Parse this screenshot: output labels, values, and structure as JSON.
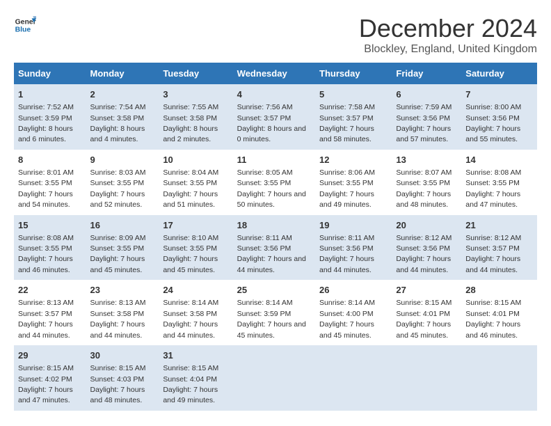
{
  "header": {
    "logo_line1": "General",
    "logo_line2": "Blue",
    "title": "December 2024",
    "subtitle": "Blockley, England, United Kingdom"
  },
  "weekdays": [
    "Sunday",
    "Monday",
    "Tuesday",
    "Wednesday",
    "Thursday",
    "Friday",
    "Saturday"
  ],
  "weeks": [
    [
      {
        "day": "1",
        "sunrise": "7:52 AM",
        "sunset": "3:59 PM",
        "daylight": "8 hours and 6 minutes."
      },
      {
        "day": "2",
        "sunrise": "7:54 AM",
        "sunset": "3:58 PM",
        "daylight": "8 hours and 4 minutes."
      },
      {
        "day": "3",
        "sunrise": "7:55 AM",
        "sunset": "3:58 PM",
        "daylight": "8 hours and 2 minutes."
      },
      {
        "day": "4",
        "sunrise": "7:56 AM",
        "sunset": "3:57 PM",
        "daylight": "8 hours and 0 minutes."
      },
      {
        "day": "5",
        "sunrise": "7:58 AM",
        "sunset": "3:57 PM",
        "daylight": "7 hours and 58 minutes."
      },
      {
        "day": "6",
        "sunrise": "7:59 AM",
        "sunset": "3:56 PM",
        "daylight": "7 hours and 57 minutes."
      },
      {
        "day": "7",
        "sunrise": "8:00 AM",
        "sunset": "3:56 PM",
        "daylight": "7 hours and 55 minutes."
      }
    ],
    [
      {
        "day": "8",
        "sunrise": "8:01 AM",
        "sunset": "3:55 PM",
        "daylight": "7 hours and 54 minutes."
      },
      {
        "day": "9",
        "sunrise": "8:03 AM",
        "sunset": "3:55 PM",
        "daylight": "7 hours and 52 minutes."
      },
      {
        "day": "10",
        "sunrise": "8:04 AM",
        "sunset": "3:55 PM",
        "daylight": "7 hours and 51 minutes."
      },
      {
        "day": "11",
        "sunrise": "8:05 AM",
        "sunset": "3:55 PM",
        "daylight": "7 hours and 50 minutes."
      },
      {
        "day": "12",
        "sunrise": "8:06 AM",
        "sunset": "3:55 PM",
        "daylight": "7 hours and 49 minutes."
      },
      {
        "day": "13",
        "sunrise": "8:07 AM",
        "sunset": "3:55 PM",
        "daylight": "7 hours and 48 minutes."
      },
      {
        "day": "14",
        "sunrise": "8:08 AM",
        "sunset": "3:55 PM",
        "daylight": "7 hours and 47 minutes."
      }
    ],
    [
      {
        "day": "15",
        "sunrise": "8:08 AM",
        "sunset": "3:55 PM",
        "daylight": "7 hours and 46 minutes."
      },
      {
        "day": "16",
        "sunrise": "8:09 AM",
        "sunset": "3:55 PM",
        "daylight": "7 hours and 45 minutes."
      },
      {
        "day": "17",
        "sunrise": "8:10 AM",
        "sunset": "3:55 PM",
        "daylight": "7 hours and 45 minutes."
      },
      {
        "day": "18",
        "sunrise": "8:11 AM",
        "sunset": "3:56 PM",
        "daylight": "7 hours and 44 minutes."
      },
      {
        "day": "19",
        "sunrise": "8:11 AM",
        "sunset": "3:56 PM",
        "daylight": "7 hours and 44 minutes."
      },
      {
        "day": "20",
        "sunrise": "8:12 AM",
        "sunset": "3:56 PM",
        "daylight": "7 hours and 44 minutes."
      },
      {
        "day": "21",
        "sunrise": "8:12 AM",
        "sunset": "3:57 PM",
        "daylight": "7 hours and 44 minutes."
      }
    ],
    [
      {
        "day": "22",
        "sunrise": "8:13 AM",
        "sunset": "3:57 PM",
        "daylight": "7 hours and 44 minutes."
      },
      {
        "day": "23",
        "sunrise": "8:13 AM",
        "sunset": "3:58 PM",
        "daylight": "7 hours and 44 minutes."
      },
      {
        "day": "24",
        "sunrise": "8:14 AM",
        "sunset": "3:58 PM",
        "daylight": "7 hours and 44 minutes."
      },
      {
        "day": "25",
        "sunrise": "8:14 AM",
        "sunset": "3:59 PM",
        "daylight": "7 hours and 45 minutes."
      },
      {
        "day": "26",
        "sunrise": "8:14 AM",
        "sunset": "4:00 PM",
        "daylight": "7 hours and 45 minutes."
      },
      {
        "day": "27",
        "sunrise": "8:15 AM",
        "sunset": "4:01 PM",
        "daylight": "7 hours and 45 minutes."
      },
      {
        "day": "28",
        "sunrise": "8:15 AM",
        "sunset": "4:01 PM",
        "daylight": "7 hours and 46 minutes."
      }
    ],
    [
      {
        "day": "29",
        "sunrise": "8:15 AM",
        "sunset": "4:02 PM",
        "daylight": "7 hours and 47 minutes."
      },
      {
        "day": "30",
        "sunrise": "8:15 AM",
        "sunset": "4:03 PM",
        "daylight": "7 hours and 48 minutes."
      },
      {
        "day": "31",
        "sunrise": "8:15 AM",
        "sunset": "4:04 PM",
        "daylight": "7 hours and 49 minutes."
      },
      null,
      null,
      null,
      null
    ]
  ]
}
